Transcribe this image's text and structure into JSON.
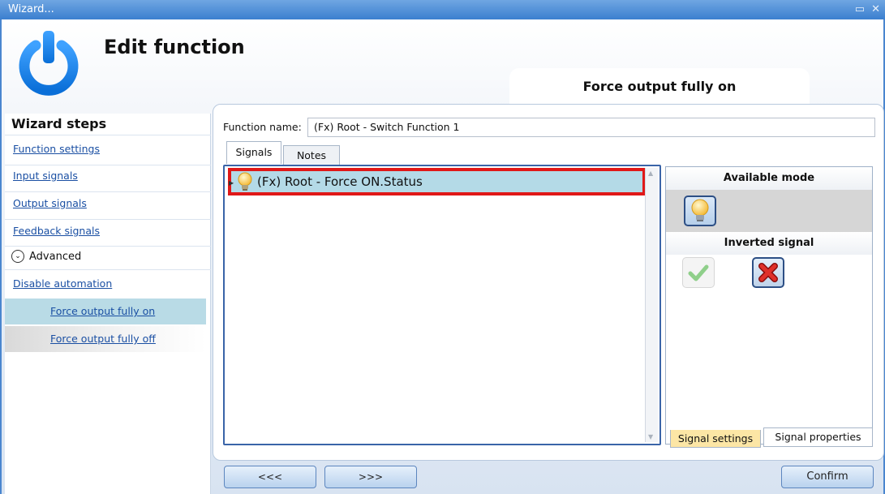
{
  "window": {
    "title": "Wizard...",
    "minimize_glyph": "▭",
    "close_glyph": "✕"
  },
  "header": {
    "title": "Edit function",
    "function_tab": "Force output fully on"
  },
  "wizard_steps": {
    "title": "Wizard steps",
    "items": [
      {
        "label": "Function settings"
      },
      {
        "label": "Input signals"
      },
      {
        "label": "Output signals"
      },
      {
        "label": "Feedback signals"
      }
    ],
    "advanced": {
      "label": "Advanced",
      "icon": "chevron-down-circle-icon",
      "items": [
        {
          "label": "Disable automation"
        },
        {
          "label": "Force output fully on",
          "active": true
        },
        {
          "label": "Force output fully off",
          "active": false
        }
      ]
    }
  },
  "function_name": {
    "label": "Function name:",
    "value": "(Fx) Root - Switch Function 1"
  },
  "tabs": [
    {
      "label": "Signals",
      "active": true
    },
    {
      "label": "Notes",
      "active": false
    }
  ],
  "signals": [
    {
      "label": "(Fx) Root - Force ON.Status",
      "icon": "lightbulb-icon",
      "selected": true,
      "highlight_color": "#e01818"
    }
  ],
  "settings": {
    "available_mode_title": "Available mode",
    "inverted_signal_title": "Inverted signal",
    "mode_icon": "lightbulb-icon",
    "inverted_options": [
      {
        "icon": "checkmark-icon",
        "selected": false
      },
      {
        "icon": "red-x-icon",
        "selected": true
      }
    ]
  },
  "bottom_tabs": [
    {
      "label": "Signal settings",
      "active": true
    },
    {
      "label": "Signal properties",
      "active": false
    }
  ],
  "footer": {
    "back_label": "<<<",
    "next_label": ">>>",
    "confirm_label": "Confirm"
  },
  "colors": {
    "titlebar": "#3b7fcf",
    "link": "#1a4fa3",
    "selected_row": "#b4dae7",
    "active_step": "#b9dbe6",
    "highlight_border": "#e01818",
    "active_bottom_tab": "#fce6a5"
  }
}
